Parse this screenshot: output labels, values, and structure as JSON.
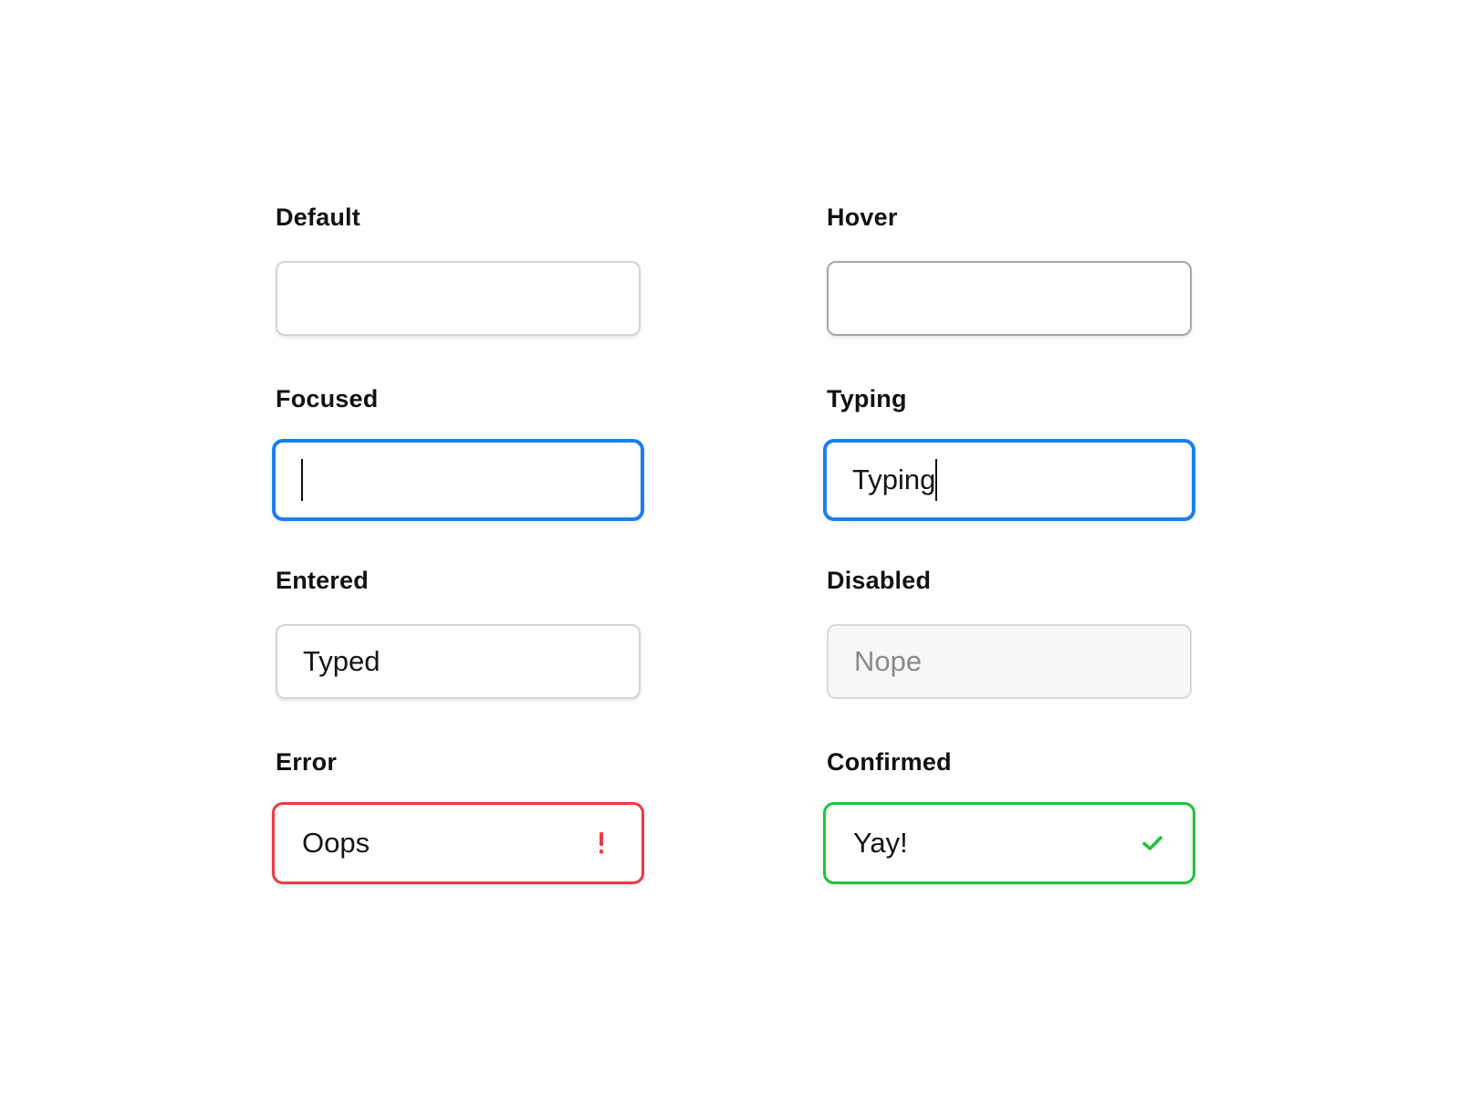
{
  "fields": {
    "default": {
      "label": "Default",
      "value": ""
    },
    "hover": {
      "label": "Hover",
      "value": ""
    },
    "focused": {
      "label": "Focused",
      "value": ""
    },
    "typing": {
      "label": "Typing",
      "value": "Typing"
    },
    "entered": {
      "label": "Entered",
      "value": "Typed"
    },
    "disabled": {
      "label": "Disabled",
      "value": "Nope"
    },
    "error": {
      "label": "Error",
      "value": "Oops",
      "icon": "exclamation-icon",
      "icon_glyph": "!"
    },
    "confirmed": {
      "label": "Confirmed",
      "value": "Yay!",
      "icon": "checkmark-icon"
    }
  },
  "colors": {
    "focus": "#1a7ff0",
    "error": "#ef3a46",
    "success": "#1ec43a",
    "border_default": "#d4d4d4",
    "border_hover": "#a6a6a6",
    "disabled_bg": "#f7f7f7"
  }
}
